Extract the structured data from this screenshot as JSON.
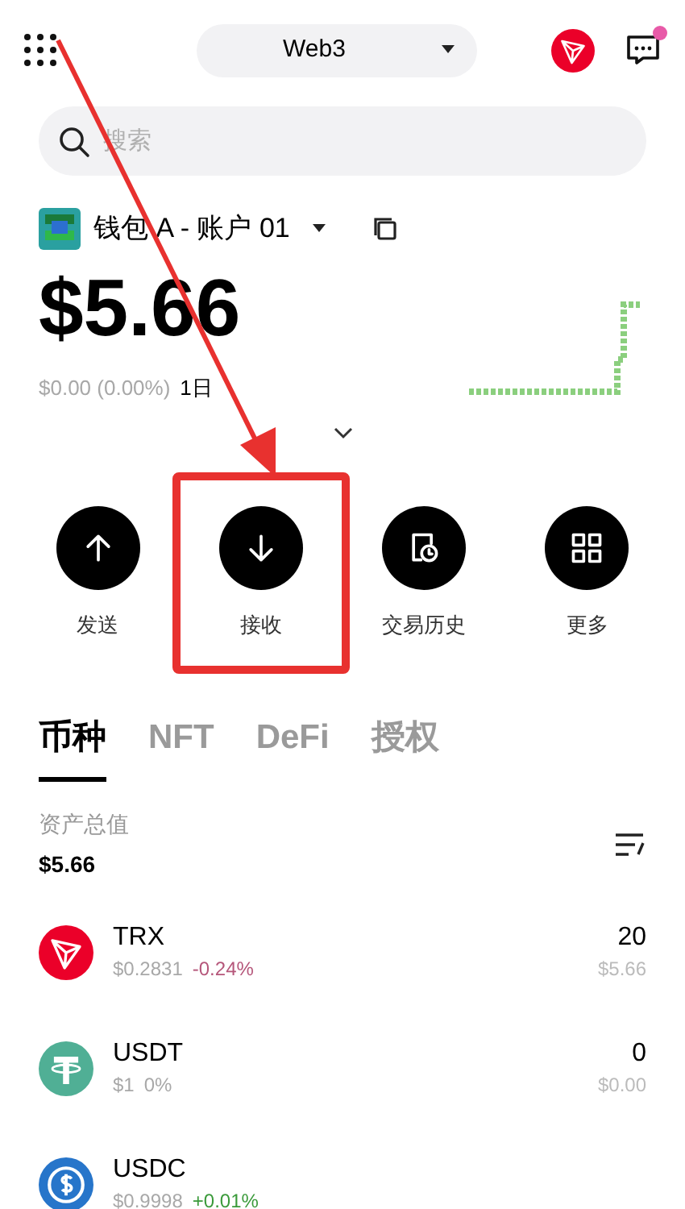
{
  "header": {
    "network": "Web3",
    "has_notification": true
  },
  "search": {
    "placeholder": "搜索"
  },
  "wallet": {
    "name": "钱包 A - 账户 01",
    "balance": "$5.66",
    "change": "$0.00 (0.00%)",
    "period": "1日"
  },
  "actions": [
    {
      "kind": "send",
      "label": "发送",
      "highlighted": false
    },
    {
      "kind": "receive",
      "label": "接收",
      "highlighted": true
    },
    {
      "kind": "history",
      "label": "交易历史",
      "highlighted": false
    },
    {
      "kind": "more",
      "label": "更多",
      "highlighted": false
    }
  ],
  "tabs": [
    {
      "label": "币种",
      "selected": true
    },
    {
      "label": "NFT",
      "selected": false
    },
    {
      "label": "DeFi",
      "selected": false
    },
    {
      "label": "授权",
      "selected": false
    }
  ],
  "total": {
    "label": "资产总值",
    "value": "$5.66"
  },
  "assets": [
    {
      "kind": "trx",
      "symbol": "TRX",
      "price": "$0.2831",
      "change": "-0.24%",
      "color": "#b5567a",
      "amount": "20",
      "value": "$5.66"
    },
    {
      "kind": "usdt",
      "symbol": "USDT",
      "price": "$1",
      "change": "0%",
      "color": "#a8a8a8",
      "amount": "0",
      "value": "$0.00"
    },
    {
      "kind": "usdc",
      "symbol": "USDC",
      "price": "$0.9998",
      "change": "+0.01%",
      "color": "#3a9a3a"
    }
  ]
}
